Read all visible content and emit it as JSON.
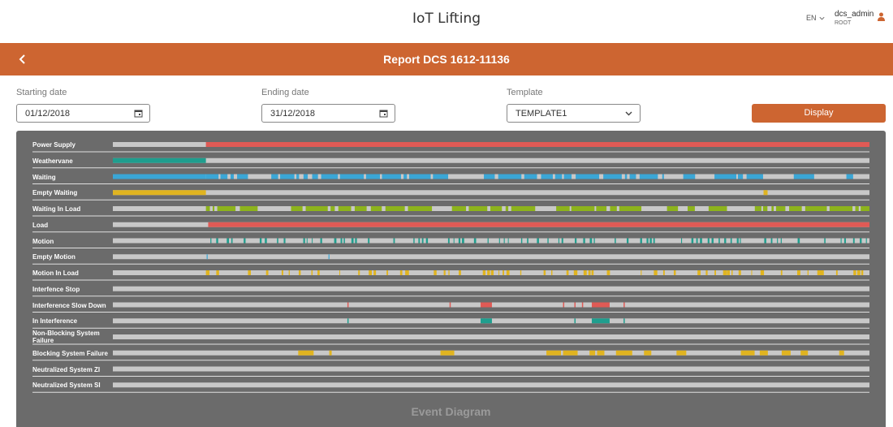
{
  "app": {
    "title": "IoT Lifting"
  },
  "header": {
    "language": "EN",
    "username": "dcs_admin",
    "role": "ROOT",
    "report_title": "Report DCS 1612-11136"
  },
  "filters": {
    "starting_date_label": "Starting date",
    "starting_date_value": "01/12/2018",
    "ending_date_label": "Ending date",
    "ending_date_value": "31/12/2018",
    "template_label": "Template",
    "template_value": "TEMPLATE1",
    "display_label": "Display"
  },
  "diagram": {
    "title": "Event Diagram",
    "colors": {
      "off": "#c8c8c8",
      "red": "#e05a55",
      "teal": "#1f9e8e",
      "blue": "#3aa6d6",
      "yellow": "#e0b420",
      "green": "#8db31c",
      "panel": "#6b6b6b"
    },
    "rows": [
      {
        "label": "Power Supply"
      },
      {
        "label": "Weathervane"
      },
      {
        "label": "Waiting"
      },
      {
        "label": "Empty Waiting"
      },
      {
        "label": "Waiting In Load"
      },
      {
        "label": "Load"
      },
      {
        "label": "Motion"
      },
      {
        "label": "Empty Motion"
      },
      {
        "label": "Motion In Load"
      },
      {
        "label": "Interfence Stop"
      },
      {
        "label": "Interference Slow Down"
      },
      {
        "label": "In Interference"
      },
      {
        "label": "Non-Blocking System Failure"
      },
      {
        "label": "Blocking System Failure"
      },
      {
        "label": "Neutralized System ZI"
      },
      {
        "label": "Neutralized System SI"
      }
    ]
  }
}
